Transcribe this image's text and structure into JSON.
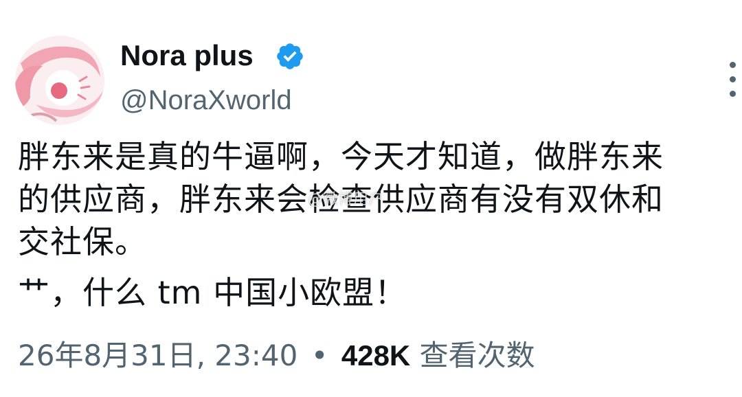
{
  "author": {
    "display_name": "Nora plus",
    "handle": "@NoraXworld",
    "avatar_icon": "avatar-pink-illustration",
    "verified_icon": "verified-badge-icon",
    "verified_color": "#1d9bf0"
  },
  "post": {
    "lines": [
      "胖东来是真的牛逼啊，今天才知道，做胖东来",
      "的供应商，胖东来会检查供应商有没有双休和",
      "交社保。",
      "艹，什么 tm 中国小欧盟！"
    ]
  },
  "watermark": "@微博用户",
  "meta": {
    "timestamp": "26年8月31日, 23:40",
    "separator": "•",
    "views": "428K",
    "views_label": "查看次数"
  },
  "menu": {
    "icon": "more-vertical-icon"
  },
  "colors": {
    "text_primary": "#0f1419",
    "text_secondary": "#536471",
    "background": "#ffffff"
  }
}
